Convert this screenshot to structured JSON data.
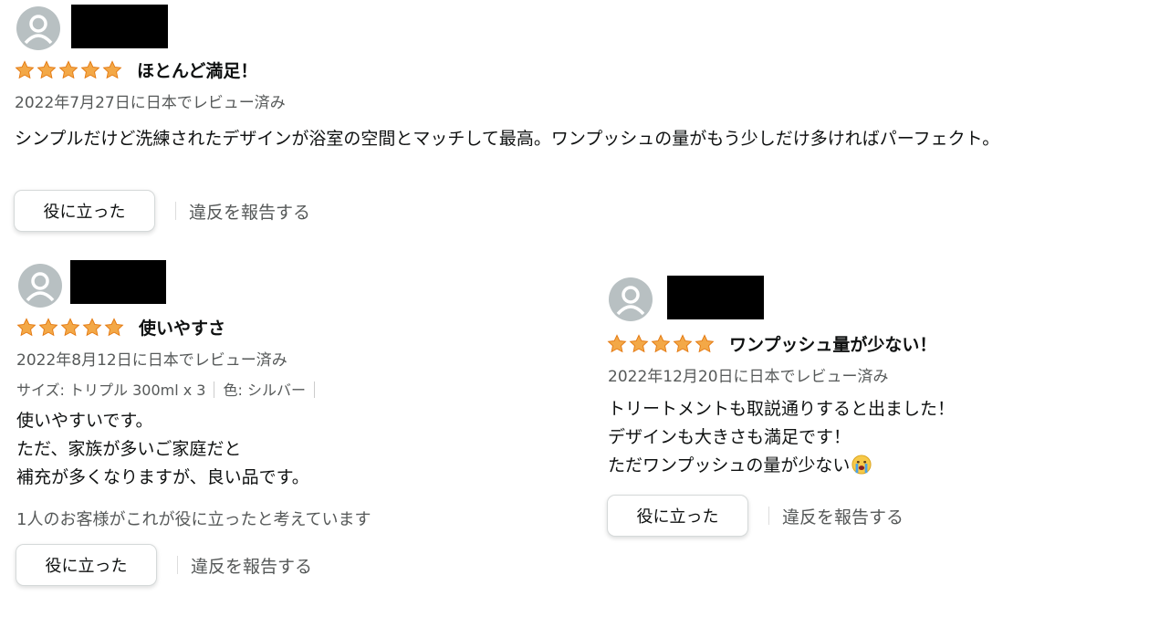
{
  "star_color": "#f3a847",
  "reviews": [
    {
      "rating": 5,
      "title": "ほとんど満足！",
      "date": "2022年7月27日に日本でレビュー済み",
      "body": [
        "シンプルだけど洗練されたデザインが浴室の空間とマッチして最高。ワンプッシュの量がもう少しだけ多ければパーフェクト。"
      ],
      "helpful_button": "役に立った",
      "report_link": "違反を報告する"
    },
    {
      "rating": 5,
      "title": "使いやすさ",
      "date": "2022年8月12日に日本でレビュー済み",
      "variant": {
        "size": "サイズ: トリプル 300ml x 3",
        "color": "色: シルバー"
      },
      "body": [
        "使いやすいです。",
        "ただ、家族が多いご家庭だと",
        "補充が多くなりますが、良い品です。"
      ],
      "helpful_count": "1人のお客様がこれが役に立ったと考えています",
      "helpful_button": "役に立った",
      "report_link": "違反を報告する"
    },
    {
      "rating": 5,
      "title": "ワンプッシュ量が少ない！",
      "date": "2022年12月20日に日本でレビュー済み",
      "body": [
        "トリートメントも取説通りすると出ました！",
        "デザインも大きさも満足です！",
        "ただワンプッシュの量が少ない"
      ],
      "emoji": "crying-face",
      "helpful_button": "役に立った",
      "report_link": "違反を報告する"
    }
  ]
}
